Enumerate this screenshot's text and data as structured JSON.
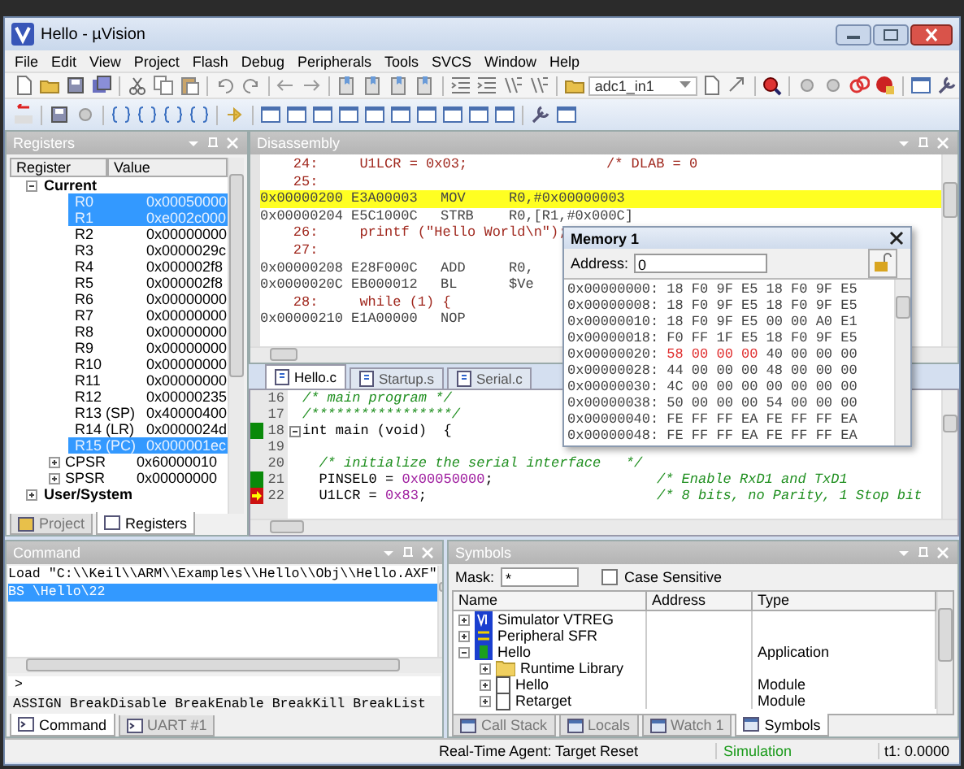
{
  "window": {
    "title": "Hello - µVision"
  },
  "menu": [
    "File",
    "Edit",
    "View",
    "Project",
    "Flash",
    "Debug",
    "Peripherals",
    "Tools",
    "SVCS",
    "Window",
    "Help"
  ],
  "target_select": {
    "value": "adc1_in1"
  },
  "registers": {
    "title": "Registers",
    "columns": [
      "Register",
      "Value"
    ],
    "tree": [
      {
        "name": "Current",
        "expanded": true,
        "children": [
          {
            "name": "R0",
            "value": "0x00050000",
            "selected": true
          },
          {
            "name": "R1",
            "value": "0xe002c000",
            "selected": true
          },
          {
            "name": "R2",
            "value": "0x00000000",
            "selected": false
          },
          {
            "name": "R3",
            "value": "0x0000029c",
            "selected": false
          },
          {
            "name": "R4",
            "value": "0x000002f8",
            "selected": false
          },
          {
            "name": "R5",
            "value": "0x000002f8",
            "selected": false
          },
          {
            "name": "R6",
            "value": "0x00000000",
            "selected": false
          },
          {
            "name": "R7",
            "value": "0x00000000",
            "selected": false
          },
          {
            "name": "R8",
            "value": "0x00000000",
            "selected": false
          },
          {
            "name": "R9",
            "value": "0x00000000",
            "selected": false
          },
          {
            "name": "R10",
            "value": "0x00000000",
            "selected": false
          },
          {
            "name": "R11",
            "value": "0x00000000",
            "selected": false
          },
          {
            "name": "R12",
            "value": "0x00000235",
            "selected": false
          },
          {
            "name": "R13 (SP)",
            "value": "0x40000400",
            "selected": false
          },
          {
            "name": "R14 (LR)",
            "value": "0x0000024d",
            "selected": false
          },
          {
            "name": "R15 (PC)",
            "value": "0x000001ec",
            "selected": true
          },
          {
            "name": "CPSR",
            "value": "0x60000010",
            "selected": false,
            "expanded": false
          },
          {
            "name": "SPSR",
            "value": "0x00000000",
            "selected": false,
            "expanded": false
          }
        ]
      },
      {
        "name": "User/System",
        "expanded": false
      }
    ],
    "tabs": [
      {
        "label": "Project",
        "selected": false
      },
      {
        "label": "Registers",
        "selected": true
      }
    ]
  },
  "disassembly": {
    "title": "Disassembly",
    "lines": [
      {
        "kind": "source",
        "text": "    24:     U1LCR = 0x03;",
        "comment": "/* DLAB = 0",
        "highlighted": false
      },
      {
        "kind": "source",
        "text": "    25:",
        "highlighted": false
      },
      {
        "kind": "asm",
        "address": "0x00000200",
        "opcode": "E3A00003",
        "mnemonic": "MOV",
        "operands": "R0,#0x00000003",
        "highlighted": true
      },
      {
        "kind": "asm",
        "address": "0x00000204",
        "opcode": "E5C1000C",
        "mnemonic": "STRB",
        "operands": "R0,[R1,#0x000C]",
        "highlighted": false
      },
      {
        "kind": "source",
        "text": "    26:     printf (\"Hello World\\n\");",
        "highlighted": false
      },
      {
        "kind": "source",
        "text": "    27:",
        "highlighted": false
      },
      {
        "kind": "asm",
        "address": "0x00000208",
        "opcode": "E28F000C",
        "mnemonic": "ADD",
        "operands": "R0,",
        "highlighted": false
      },
      {
        "kind": "asm",
        "address": "0x0000020C",
        "opcode": "EB000012",
        "mnemonic": "BL",
        "operands": "$Ve",
        "highlighted": false
      },
      {
        "kind": "source",
        "text": "    28:     while (1) {",
        "highlighted": false
      },
      {
        "kind": "asm",
        "address": "0x00000210",
        "opcode": "E1A00000",
        "mnemonic": "NOP",
        "highlighted": false
      }
    ]
  },
  "editor": {
    "tabs": [
      {
        "label": "Hello.c",
        "selected": true
      },
      {
        "label": "Startup.s",
        "selected": false
      },
      {
        "label": "Serial.c",
        "selected": false
      }
    ],
    "lines": [
      {
        "number": "16",
        "executed": false,
        "current": false,
        "segments": [
          {
            "kind": "comment",
            "text": "/* main program */"
          }
        ]
      },
      {
        "number": "17",
        "executed": false,
        "current": false,
        "segments": [
          {
            "kind": "comment",
            "text": "/*****************/"
          }
        ]
      },
      {
        "number": "18",
        "executed": true,
        "current": false,
        "fold": true,
        "segments": [
          {
            "kind": "plain",
            "text": "int main (void)  {"
          }
        ]
      },
      {
        "number": "19",
        "executed": false,
        "current": false
      },
      {
        "number": "20",
        "executed": false,
        "current": false,
        "segments": [
          {
            "kind": "comment",
            "text": "  /* initialize the serial interface   */"
          }
        ]
      },
      {
        "number": "21",
        "executed": true,
        "current": false,
        "segments": [
          {
            "kind": "plain",
            "text": "  PINSEL0 = "
          },
          {
            "kind": "number",
            "text": "0x00050000"
          },
          {
            "kind": "plain",
            "text": ";"
          }
        ],
        "comment": "/* Enable RxD1 and TxD1"
      },
      {
        "number": "22",
        "executed": true,
        "current": true,
        "segments": [
          {
            "kind": "plain",
            "text": "  U1LCR = "
          },
          {
            "kind": "number",
            "text": "0x83"
          },
          {
            "kind": "plain",
            "text": ";"
          }
        ],
        "comment": "/* 8 bits, no Parity, 1 Stop bit"
      }
    ]
  },
  "memory": {
    "title": "Memory 1",
    "address_label": "Address:",
    "address": "0",
    "rows": [
      {
        "address": "0x00000000:",
        "groups": [
          {
            "bytes": "18 F0 9F E5",
            "changed": false
          },
          {
            "bytes": "18 F0 9F E5",
            "changed": false
          }
        ]
      },
      {
        "address": "0x00000008:",
        "groups": [
          {
            "bytes": "18 F0 9F E5",
            "changed": false
          },
          {
            "bytes": "18 F0 9F E5",
            "changed": false
          }
        ]
      },
      {
        "address": "0x00000010:",
        "groups": [
          {
            "bytes": "18 F0 9F E5",
            "changed": false
          },
          {
            "bytes": "00 00 A0 E1",
            "changed": false
          }
        ]
      },
      {
        "address": "0x00000018:",
        "groups": [
          {
            "bytes": "F0 FF 1F E5",
            "changed": false
          },
          {
            "bytes": "18 F0 9F E5",
            "changed": false
          }
        ]
      },
      {
        "address": "0x00000020:",
        "groups": [
          {
            "bytes": "58 00 00 00",
            "changed": true
          },
          {
            "bytes": "40 00 00 00",
            "changed": false
          }
        ]
      },
      {
        "address": "0x00000028:",
        "groups": [
          {
            "bytes": "44 00 00 00",
            "changed": false
          },
          {
            "bytes": "48 00 00 00",
            "changed": false
          }
        ]
      },
      {
        "address": "0x00000030:",
        "groups": [
          {
            "bytes": "4C 00 00 00",
            "changed": false
          },
          {
            "bytes": "00 00 00 00",
            "changed": false
          }
        ]
      },
      {
        "address": "0x00000038:",
        "groups": [
          {
            "bytes": "50 00 00 00",
            "changed": false
          },
          {
            "bytes": "54 00 00 00",
            "changed": false
          }
        ]
      },
      {
        "address": "0x00000040:",
        "groups": [
          {
            "bytes": "FE FF FF EA",
            "changed": false
          },
          {
            "bytes": "FE FF FF EA",
            "changed": false
          }
        ]
      },
      {
        "address": "0x00000048:",
        "groups": [
          {
            "bytes": "FE FF FF EA",
            "changed": false
          },
          {
            "bytes": "FE FF FF EA",
            "changed": false
          }
        ]
      }
    ]
  },
  "command": {
    "title": "Command",
    "output": [
      {
        "text": "Load \"C:\\\\Keil\\\\ARM\\\\Examples\\\\Hello\\\\Obj\\\\Hello.AXF\"",
        "selected": false
      },
      {
        "text": "BS \\Hello\\22",
        "selected": true
      }
    ],
    "prompt": ">",
    "hint": "ASSIGN BreakDisable BreakEnable BreakKill BreakList",
    "tabs": [
      {
        "label": "Command",
        "selected": true
      },
      {
        "label": "UART #1",
        "selected": false
      }
    ]
  },
  "symbols": {
    "title": "Symbols",
    "mask_label": "Mask:",
    "mask": "*",
    "case_sensitive": {
      "label": "Case Sensitive",
      "checked": false
    },
    "columns": [
      "Name",
      "Address",
      "Type"
    ],
    "tree": [
      {
        "name": "Simulator VTREG",
        "kind": "vtreg",
        "expanded": false
      },
      {
        "name": "Peripheral SFR",
        "kind": "sfr",
        "expanded": false
      },
      {
        "name": "Hello",
        "kind": "app",
        "expanded": true,
        "type": "Application",
        "children": [
          {
            "name": "Runtime Library",
            "kind": "folder",
            "expanded": false
          },
          {
            "name": "Hello",
            "kind": "module",
            "expanded": false,
            "type": "Module"
          },
          {
            "name": "Retarget",
            "kind": "module",
            "expanded": false,
            "type": "Module"
          }
        ]
      }
    ],
    "tabs": [
      {
        "label": "Call Stack",
        "selected": false
      },
      {
        "label": "Locals",
        "selected": false
      },
      {
        "label": "Watch 1",
        "selected": false
      },
      {
        "label": "Symbols",
        "selected": true
      }
    ]
  },
  "status_bar": {
    "agent": "Real-Time Agent: Target Reset",
    "mode": "Simulation",
    "time": "t1: 0.0000"
  }
}
